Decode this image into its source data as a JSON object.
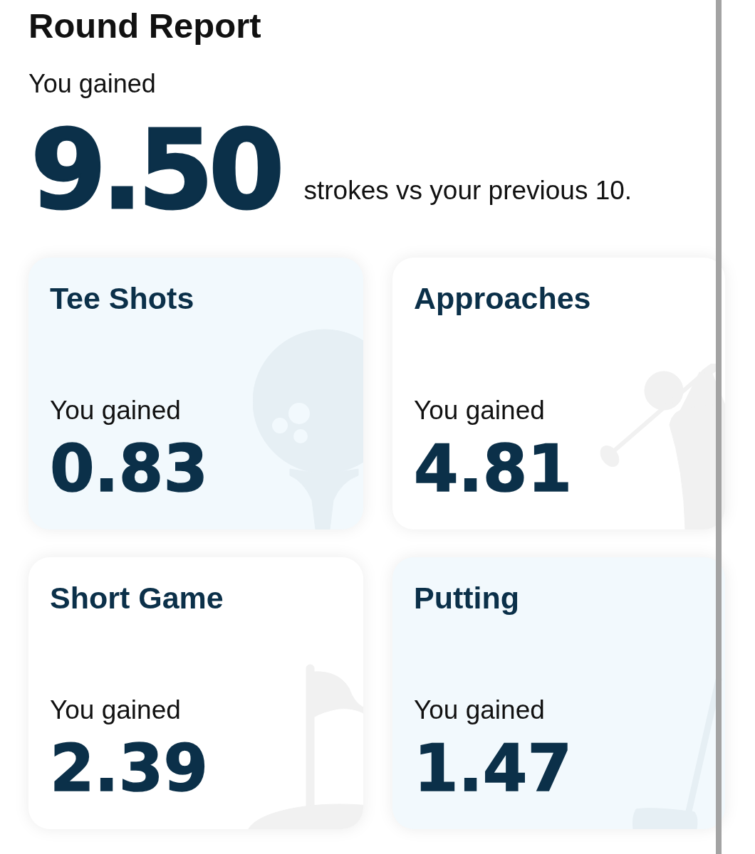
{
  "title": "Round Report",
  "summary": {
    "label": "You gained",
    "value": "9.50",
    "caption": "strokes vs your previous 10."
  },
  "categories": [
    {
      "kind": "tee_shots",
      "title": "Tee Shots",
      "label": "You gained",
      "value": "0.83"
    },
    {
      "kind": "approaches",
      "title": "Approaches",
      "label": "You gained",
      "value": "4.81"
    },
    {
      "kind": "short_game",
      "title": "Short Game",
      "label": "You gained",
      "value": "2.39"
    },
    {
      "kind": "putting",
      "title": "Putting",
      "label": "You gained",
      "value": "1.47"
    }
  ]
}
